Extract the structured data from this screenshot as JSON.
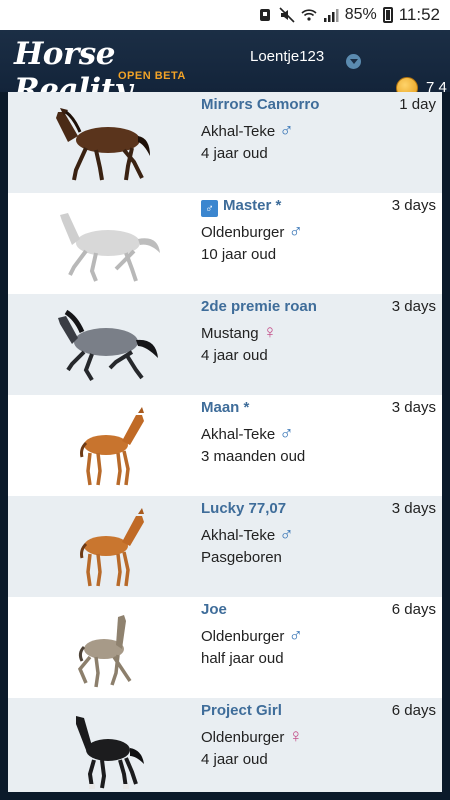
{
  "status_bar": {
    "battery_percent": "85%",
    "time": "11:52",
    "icons": [
      "notification-icon",
      "mute-icon",
      "wifi-icon",
      "signal-icon",
      "battery-icon"
    ]
  },
  "header": {
    "logo_text": "Horse Reality",
    "logo_badge": "OPEN BETA",
    "username": "Loentje123",
    "currency_value": "7 4"
  },
  "horses": [
    {
      "name": "Mirrors Camorro",
      "breed": "Akhal-Teke",
      "sex_symbol": "♂",
      "age": "4 jaar oud",
      "time": "1 day",
      "coat": "bay"
    },
    {
      "name": "Master *",
      "breed": "Oldenburger",
      "sex_symbol": "♂",
      "age": "10 jaar oud",
      "time": "3 days",
      "coat": "grey"
    },
    {
      "name": "2de premie roan",
      "breed": "Mustang",
      "sex_symbol": "♀",
      "age": "4 jaar oud",
      "time": "3 days",
      "coat": "blue-roan"
    },
    {
      "name": "Maan *",
      "breed": "Akhal-Teke",
      "sex_symbol": "♂",
      "age": "3 maanden oud",
      "time": "3 days",
      "coat": "chestnut-foal"
    },
    {
      "name": "Lucky 77,07",
      "breed": "Akhal-Teke",
      "sex_symbol": "♂",
      "age": "Pasgeboren",
      "time": "3 days",
      "coat": "chestnut-foal"
    },
    {
      "name": "Joe",
      "breed": "Oldenburger",
      "sex_symbol": "♂",
      "age": "half jaar oud",
      "time": "6 days",
      "coat": "dun-foal"
    },
    {
      "name": "Project Girl",
      "breed": "Oldenburger",
      "sex_symbol": "♀",
      "age": "4 jaar oud",
      "time": "6 days",
      "coat": "black-foal"
    }
  ],
  "colors": {
    "header_bg": "#13243a",
    "name_link": "#3f6d9a",
    "male": "#2f6fb3",
    "female": "#c4508a",
    "accent": "#f2a327"
  }
}
